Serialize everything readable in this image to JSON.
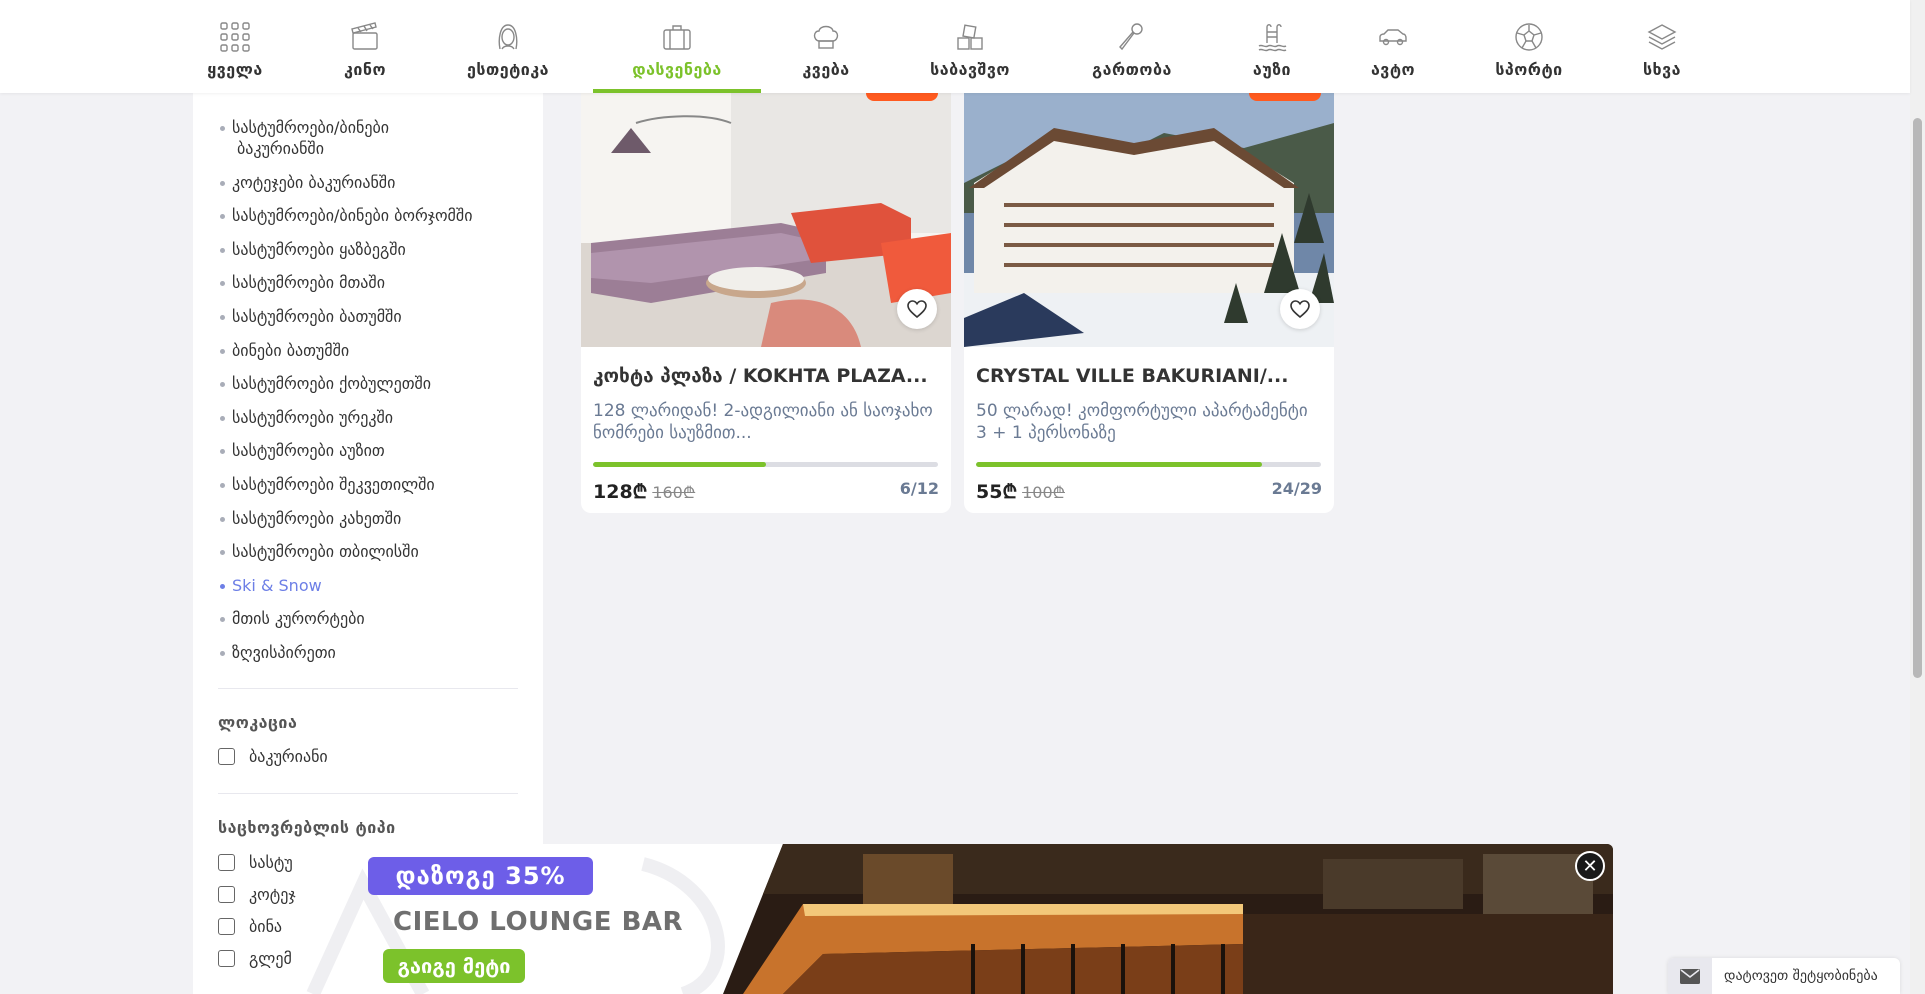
{
  "nav": [
    {
      "label": "ყველა",
      "icon": "grid-icon"
    },
    {
      "label": "კინო",
      "icon": "clapperboard-icon"
    },
    {
      "label": "ესთეტიკა",
      "icon": "woman-face-icon"
    },
    {
      "label": "დასვენება",
      "icon": "suitcase-icon",
      "active": true
    },
    {
      "label": "კვება",
      "icon": "chef-hat-icon"
    },
    {
      "label": "საბავშვო",
      "icon": "toy-blocks-icon"
    },
    {
      "label": "გართობა",
      "icon": "microphone-icon"
    },
    {
      "label": "აუზი",
      "icon": "pool-icon"
    },
    {
      "label": "ავტო",
      "icon": "car-icon"
    },
    {
      "label": "სპორტი",
      "icon": "soccer-ball-icon"
    },
    {
      "label": "სხვა",
      "icon": "layers-icon"
    }
  ],
  "sidebar": {
    "categories": [
      {
        "label": "სასტუმროები/ბინები",
        "label2": "ბაკურიანში"
      },
      {
        "label": "კოტეჯები ბაკურიანში"
      },
      {
        "label": "სასტუმროები/ბინები ბორჯომში"
      },
      {
        "label": "სასტუმროები ყაზბეგში"
      },
      {
        "label": "სასტუმროები მთაში"
      },
      {
        "label": "სასტუმროები ბათუმში"
      },
      {
        "label": "ბინები ბათუმში"
      },
      {
        "label": "სასტუმროები ქობულეთში"
      },
      {
        "label": "სასტუმროები ურეკში"
      },
      {
        "label": "სასტუმროები აუზით"
      },
      {
        "label": "სასტუმროები შეკვეთილში"
      },
      {
        "label": "სასტუმროები კახეთში"
      },
      {
        "label": "სასტუმროები თბილისში"
      },
      {
        "label": "Ski & Snow",
        "highlight": true
      },
      {
        "label": "მთის კურორტები"
      },
      {
        "label": "ზღვისპირეთი"
      }
    ],
    "location": {
      "title": "ლოკაცია",
      "options": [
        "ბაკურიანი"
      ]
    },
    "accommodation": {
      "title": "საცხოვრებლის ტიპი",
      "options": [
        "სასტუ",
        "კოტეჯ",
        "ბინა",
        "გლემ"
      ]
    }
  },
  "cards": [
    {
      "title": "კოხტა პლაზა / KOKHTA PLAZA...",
      "desc": "128 ლარიდან! 2-ადგილიანი ან საოჯახო ნომრები საუზმით...",
      "price": "128₾",
      "old_price": "160₾",
      "sold": "6/12",
      "progress": 0.5
    },
    {
      "title": "CRYSTAL VILLE BAKURIANI/...",
      "desc": "50 ლარად! კომფორტული აპარტამენტი 3 + 1 პერსონაზე",
      "price": "55₾",
      "old_price": "100₾",
      "sold": "24/29",
      "progress": 0.83
    }
  ],
  "banner": {
    "discount": "დაზოგე 35%",
    "name": "CIELO LOUNGE BAR",
    "cta": "გაიგე მეტი"
  },
  "message_widget": {
    "label": "დატოვეთ შეტყობინება"
  },
  "colors": {
    "accent": "#7cc22b",
    "link": "#6d7fe6",
    "badge": "#ff5a1f",
    "banner_discount": "#6d5ee8"
  }
}
